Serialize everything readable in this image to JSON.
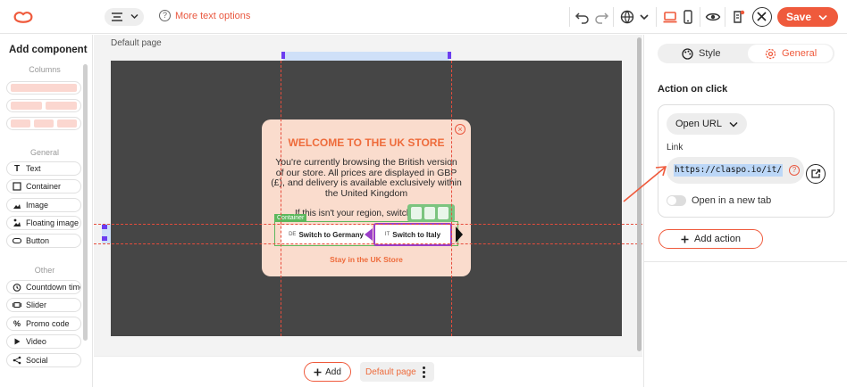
{
  "topbar": {
    "more_text": "More text options",
    "save_label": "Save"
  },
  "sidebar": {
    "title": "Add component",
    "sections": {
      "columns": "Columns",
      "general": "General",
      "other": "Other"
    },
    "general_items": [
      "Text",
      "Container",
      "Image",
      "Floating image",
      "Button"
    ],
    "other_items": [
      "Countdown timer",
      "Slider",
      "Promo code",
      "Video",
      "Social"
    ]
  },
  "canvas": {
    "page_label": "Default page",
    "popup": {
      "title": "WELCOME TO THE UK STORE",
      "body": "You're currently browsing the British version of our store. All prices are displayed in GBP (£), and delivery is available exclusively within the United Kingdom",
      "region_text": "If this isn't your region, switch now",
      "container_tag": "Container",
      "btn_de_flag": "DE",
      "btn_de": "Switch to Germany",
      "btn_it_flag": "IT",
      "btn_it": "Switch to Italy",
      "stay_link": "Stay in the UK Store",
      "close_glyph": "×"
    }
  },
  "bottombar": {
    "add_label": "Add",
    "page_name": "Default page"
  },
  "panel": {
    "tab_style": "Style",
    "tab_general": "General",
    "heading": "Action on click",
    "action_type": "Open URL",
    "link_label": "Link",
    "link_value": "https://claspo.io/it/",
    "toggle_label": "Open in a new tab",
    "add_action": "Add action"
  },
  "colors": {
    "accent": "#ef5a3c",
    "popup_bg": "#fadccd",
    "stage_bg": "#464646"
  }
}
